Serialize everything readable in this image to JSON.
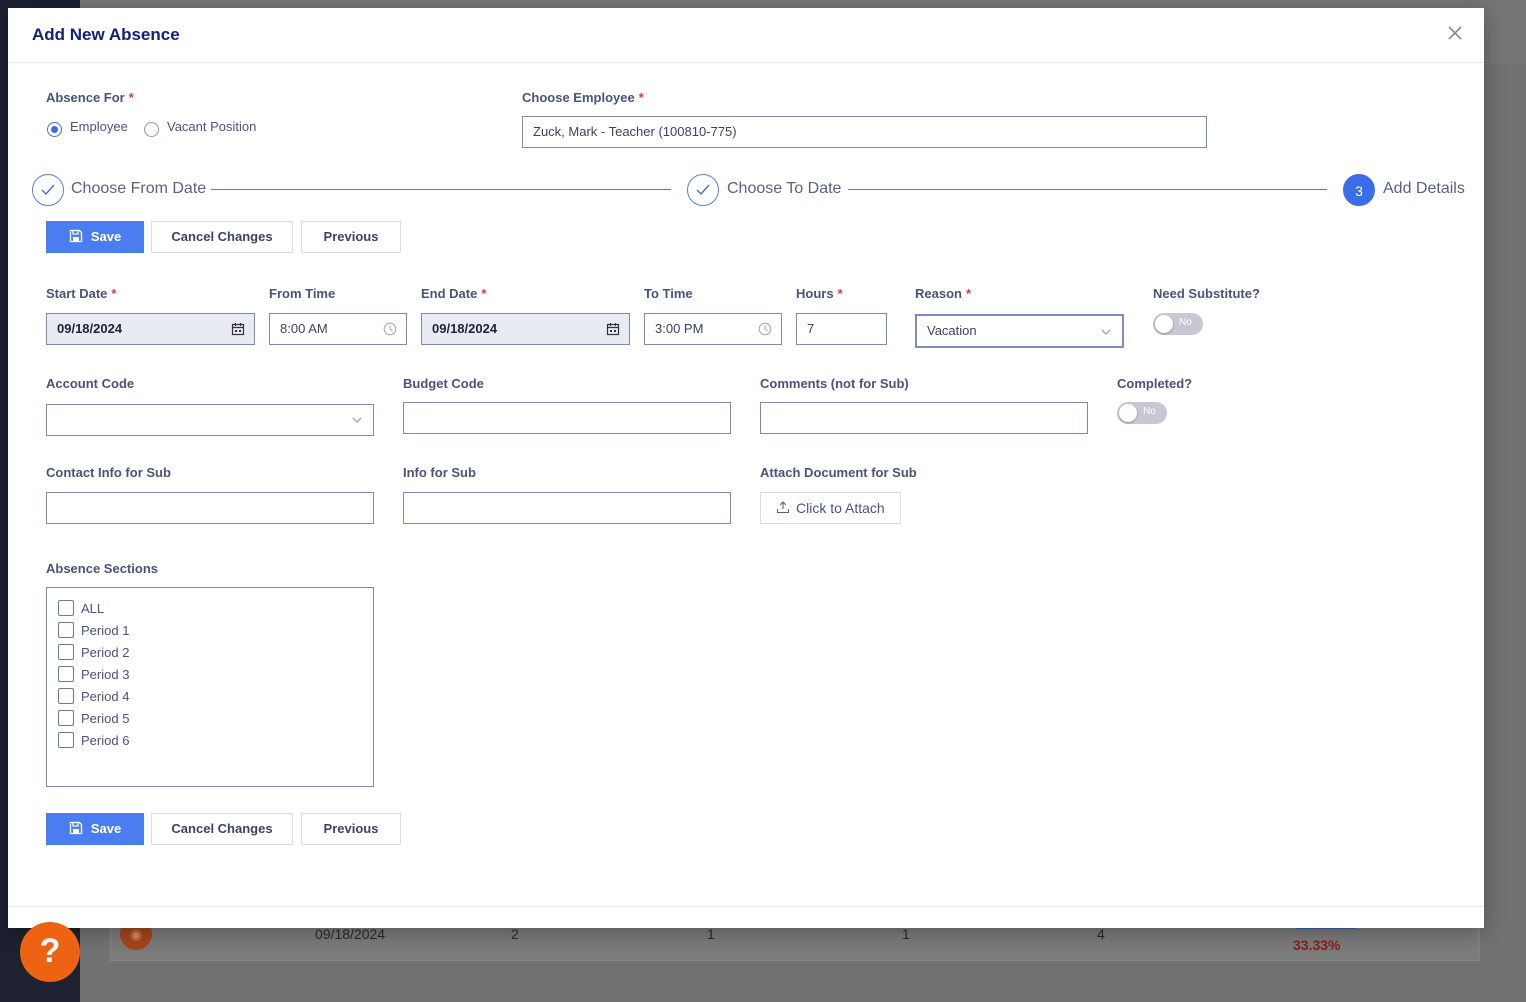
{
  "modal": {
    "title": "Add New Absence"
  },
  "absence_for": {
    "label": "Absence For",
    "options": [
      "Employee",
      "Vacant Position"
    ],
    "selected": "Employee"
  },
  "employee": {
    "label": "Choose Employee",
    "value": "Zuck, Mark - Teacher (100810-775)"
  },
  "stepper": {
    "steps": [
      {
        "label": "Choose From Date",
        "state": "done"
      },
      {
        "label": "Choose To Date",
        "state": "done"
      },
      {
        "label": "Add Details",
        "state": "active",
        "number": "3"
      }
    ]
  },
  "buttons": {
    "save": "Save",
    "cancel": "Cancel Changes",
    "previous": "Previous"
  },
  "fields": {
    "start_date": {
      "label": "Start Date",
      "value": "09/18/2024"
    },
    "from_time": {
      "label": "From Time",
      "value": "8:00 AM"
    },
    "end_date": {
      "label": "End Date",
      "value": "09/18/2024"
    },
    "to_time": {
      "label": "To Time",
      "value": "3:00 PM"
    },
    "hours": {
      "label": "Hours",
      "value": "7"
    },
    "reason": {
      "label": "Reason",
      "value": "Vacation"
    },
    "need_sub": {
      "label": "Need Substitute?",
      "value": "No"
    },
    "account_code": {
      "label": "Account Code",
      "value": ""
    },
    "budget_code": {
      "label": "Budget Code",
      "value": ""
    },
    "comments": {
      "label": "Comments (not for Sub)",
      "value": ""
    },
    "completed": {
      "label": "Completed?",
      "value": "No"
    },
    "contact_info": {
      "label": "Contact Info for Sub",
      "value": ""
    },
    "info_for_sub": {
      "label": "Info for Sub",
      "value": ""
    },
    "attach": {
      "label": "Attach Document for Sub",
      "button": "Click to Attach"
    }
  },
  "sections": {
    "label": "Absence Sections",
    "items": [
      "ALL",
      "Period 1",
      "Period 2",
      "Period 3",
      "Period 4",
      "Period 5",
      "Period 6"
    ]
  },
  "background_row": {
    "date": "09/18/2024",
    "c1": "2",
    "c2": "1",
    "c3": "1",
    "c4": "4",
    "percent": "33.33%"
  },
  "help": {
    "label": "?"
  },
  "colors": {
    "primary": "#4a7ef0",
    "title": "#12217a",
    "help": "#ee6312"
  }
}
